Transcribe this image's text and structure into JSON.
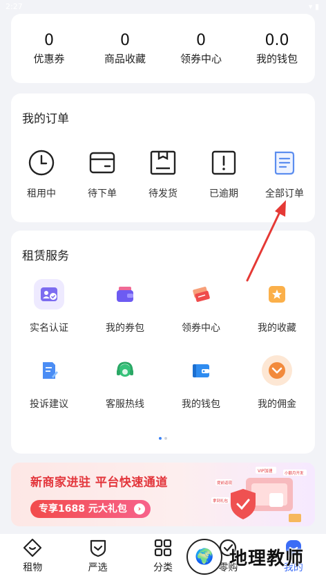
{
  "status_bar": {
    "time": "2:27"
  },
  "stats": [
    {
      "value": "0",
      "label": "优惠券"
    },
    {
      "value": "0",
      "label": "商品收藏"
    },
    {
      "value": "0",
      "label": "领券中心"
    },
    {
      "value": "0.0",
      "label": "我的钱包"
    }
  ],
  "orders": {
    "title": "我的订单",
    "items": [
      {
        "icon": "clock-icon",
        "label": "租用中"
      },
      {
        "icon": "card-icon",
        "label": "待下单"
      },
      {
        "icon": "box-icon",
        "label": "待发货"
      },
      {
        "icon": "alert-icon",
        "label": "已逾期"
      },
      {
        "icon": "document-icon",
        "label": "全部订单"
      }
    ]
  },
  "services": {
    "title": "租赁服务",
    "items": [
      {
        "icon": "id-card-icon",
        "label": "实名认证"
      },
      {
        "icon": "wallet-icon",
        "label": "我的券包"
      },
      {
        "icon": "coupon-icon",
        "label": "领券中心"
      },
      {
        "icon": "star-icon",
        "label": "我的收藏"
      },
      {
        "icon": "edit-document-icon",
        "label": "投诉建议"
      },
      {
        "icon": "headset-icon",
        "label": "客服热线"
      },
      {
        "icon": "wallet-blue-icon",
        "label": "我的钱包"
      },
      {
        "icon": "commission-icon",
        "label": "我的佣金"
      }
    ]
  },
  "banner": {
    "title": "新商家进驻 平台快速通道",
    "button": "专享1688 元大礼包",
    "art_tags": [
      "VIP加速",
      "提前返现",
      "小额月开发",
      "拿到礼包"
    ]
  },
  "tabbar": [
    {
      "icon": "lease-icon",
      "label": "租物"
    },
    {
      "icon": "shield-check-icon",
      "label": "严选"
    },
    {
      "icon": "grid-icon",
      "label": "分类"
    },
    {
      "icon": "badge-check-icon",
      "label": "零购"
    },
    {
      "icon": "profile-icon",
      "label": "我的"
    }
  ],
  "watermark": {
    "text": "地理教师"
  },
  "colors": {
    "accent": "#3b6cf6",
    "banner_red": "#e3353b",
    "arrow_red": "#e53935"
  }
}
